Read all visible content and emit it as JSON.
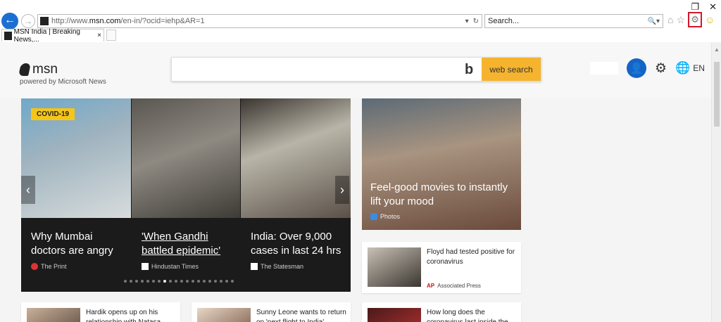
{
  "browser": {
    "url_prefix": "http://www.",
    "url_domain": "msn.com",
    "url_suffix": "/en-in/?ocid=iehp&AR=1",
    "search_placeholder": "Search...",
    "tab_title": "MSN India | Breaking News,...",
    "tab_close": "×",
    "window_restore": "❐",
    "window_close": "✕"
  },
  "header": {
    "logo_text": "msn",
    "powered_by": "powered by Microsoft News",
    "search_button": "web search",
    "bing_glyph": "b",
    "language": "EN"
  },
  "carousel": {
    "badge": "COVID-19",
    "slides": [
      {
        "title": "Why Mumbai doctors are angry",
        "source": "The Print"
      },
      {
        "title": "'When Gandhi battled epidemic'",
        "source": "Hindustan Times"
      },
      {
        "title": "India: Over 9,000 cases in last 24 hrs",
        "source": "The Statesman"
      }
    ],
    "dot_count": 20,
    "active_dot": 7
  },
  "feature": {
    "title": "Feel-good movies to instantly lift your mood",
    "source": "Photos"
  },
  "cards": [
    {
      "title": "Floyd had tested positive for coronavirus",
      "source_logo": "AP",
      "source": "Associated Press"
    },
    {
      "title": "Hardik opens up on his relationship with Natasa",
      "source": ""
    },
    {
      "title": "Sunny Leone wants to return on 'next flight to India'",
      "source": ""
    },
    {
      "title": "How long does the coronavirus last inside the",
      "source": ""
    }
  ],
  "icons": {
    "back": "back-arrow-icon",
    "forward": "forward-arrow-icon",
    "refresh": "refresh-icon",
    "home": "home-icon",
    "favorites": "star-icon",
    "tools": "gear-icon",
    "feedback": "smiley-icon",
    "user": "user-avatar-icon",
    "settings": "gear-icon",
    "language": "globe-icon"
  },
  "colors": {
    "accent": "#1464c7",
    "search_button": "#f5b32e",
    "badge": "#f5c518",
    "highlight_box": "#d3182a"
  }
}
